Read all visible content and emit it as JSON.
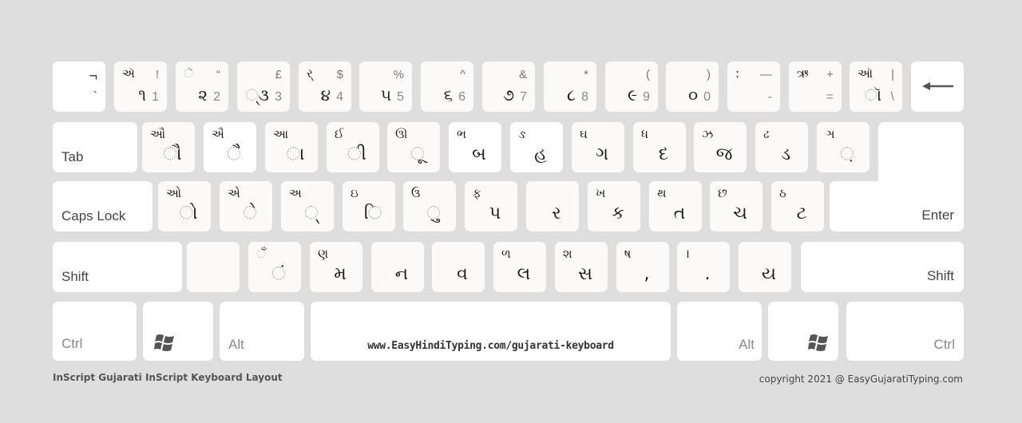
{
  "row1": [
    {
      "shift": "¬",
      "base": "`"
    },
    {
      "shift_g": "ઍ",
      "shift_s": "!",
      "base_g": "૧",
      "base_s": "1"
    },
    {
      "shift_g": "ૅ",
      "shift_s": "“",
      "base_g": "૨",
      "base_s": "2"
    },
    {
      "shift_g": "",
      "shift_s": "£",
      "base_g": "્૩",
      "base_s": "3"
    },
    {
      "shift_g": "ર્",
      "shift_s": "$",
      "base_g": "૪",
      "base_s": "4"
    },
    {
      "shift_g": "",
      "shift_s": "%",
      "base_g": "૫",
      "base_s": "5"
    },
    {
      "shift_g": "",
      "shift_s": "^",
      "base_g": "૬",
      "base_s": "6"
    },
    {
      "shift_g": "",
      "shift_s": "&",
      "base_g": "૭",
      "base_s": "7"
    },
    {
      "shift_g": "",
      "shift_s": "*",
      "base_g": "૮",
      "base_s": "8"
    },
    {
      "shift_g": "",
      "shift_s": "(",
      "base_g": "૯",
      "base_s": "9"
    },
    {
      "shift_g": "",
      "shift_s": ")",
      "base_g": "૦",
      "base_s": "0"
    },
    {
      "shift_g": ":",
      "shift_s": "—",
      "base_g": "",
      "base_s": "-"
    },
    {
      "shift_g": "ઋ",
      "shift_s": "+",
      "base_g": "",
      "base_s": "="
    },
    {
      "shift_g": "ઑ",
      "shift_s": "|",
      "base_g": "ૉ",
      "base_s": "\\"
    }
  ],
  "backspace_icon": "←",
  "row2": [
    {
      "shift": "ઔ",
      "base": "ૌ"
    },
    {
      "shift": "ઐ",
      "base": "ૈ"
    },
    {
      "shift": "આ",
      "base": "ા"
    },
    {
      "shift": "ઈ",
      "base": "ી"
    },
    {
      "shift": "ઊ",
      "base": "ૂ"
    },
    {
      "shift": "ભ",
      "base": "બ"
    },
    {
      "shift": "ઙ",
      "base": "હ"
    },
    {
      "shift": "ઘ",
      "base": "ગ"
    },
    {
      "shift": "ધ",
      "base": "દ"
    },
    {
      "shift": "ઝ",
      "base": "જ"
    },
    {
      "shift": "ઢ",
      "base": "ડ"
    },
    {
      "shift": "ઞ",
      "base": "઼"
    }
  ],
  "row3": [
    {
      "shift": "ઓ",
      "base": "ો"
    },
    {
      "shift": "એ",
      "base": "ે"
    },
    {
      "shift": "અ",
      "base": "્"
    },
    {
      "shift": "ઇ",
      "base": "િ"
    },
    {
      "shift": "ઉ",
      "base": "ુ"
    },
    {
      "shift": "ફ",
      "base": "પ"
    },
    {
      "shift": "",
      "base": "ર"
    },
    {
      "shift": "ખ",
      "base": "ક"
    },
    {
      "shift": "થ",
      "base": "ત"
    },
    {
      "shift": "છ",
      "base": "ચ"
    },
    {
      "shift": "ઠ",
      "base": "ટ"
    }
  ],
  "row4": [
    {
      "shift": "",
      "base": ""
    },
    {
      "shift": "ઁ",
      "base": "ં"
    },
    {
      "shift": "ણ",
      "base": "મ"
    },
    {
      "shift": "",
      "base": "ન"
    },
    {
      "shift": "",
      "base": "વ"
    },
    {
      "shift": "ળ",
      "base": "લ"
    },
    {
      "shift": "શ",
      "base": "સ"
    },
    {
      "shift": "ષ",
      "base": ","
    },
    {
      "shift": "।",
      "base": "."
    },
    {
      "shift": "",
      "base": "ય"
    }
  ],
  "mods": {
    "tab": "Tab",
    "caps": "Caps Lock",
    "enter": "Enter",
    "shift_l": "Shift",
    "shift_r": "Shift",
    "ctrl_l": "Ctrl",
    "alt_l": "Alt",
    "alt_r": "Alt",
    "ctrl_r": "Ctrl"
  },
  "space_url": "www.EasyHindiTyping.com/gujarati-keyboard",
  "footer_left": "InScript Gujarati InScript Keyboard Layout",
  "footer_right": "copyright 2021 @ EasyGujaratiTyping.com"
}
